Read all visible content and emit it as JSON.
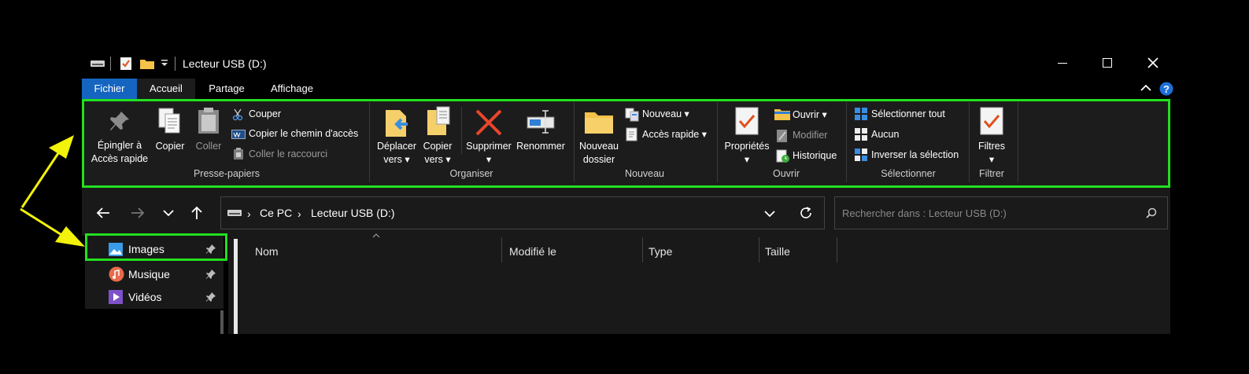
{
  "titlebar": {
    "title": "Lecteur USB (D:)"
  },
  "ribbon_tabs": [
    {
      "label": "Fichier"
    },
    {
      "label": "Accueil"
    },
    {
      "label": "Partage"
    },
    {
      "label": "Affichage"
    }
  ],
  "clipboard": {
    "pin_label_1": "Épingler à",
    "pin_label_2": "Accès rapide",
    "copy_label": "Copier",
    "paste_label": "Coller",
    "cut_label": "Couper",
    "copy_path_label": "Copier le chemin d'accès",
    "paste_shortcut_label": "Coller le raccourci",
    "group_label": "Presse-papiers"
  },
  "organize": {
    "move_label_1": "Déplacer",
    "move_label_2": "vers",
    "copyto_label_1": "Copier",
    "copyto_label_2": "vers",
    "delete_label": "Supprimer",
    "rename_label": "Renommer",
    "group_label": "Organiser"
  },
  "new": {
    "new_folder_label_1": "Nouveau",
    "new_folder_label_2": "dossier",
    "new_item_label": "Nouveau",
    "quick_access_label": "Accès rapide",
    "group_label": "Nouveau"
  },
  "open": {
    "properties_label": "Propriétés",
    "open_label": "Ouvrir",
    "edit_label": "Modifier",
    "history_label": "Historique",
    "group_label": "Ouvrir"
  },
  "select": {
    "select_all_label": "Sélectionner tout",
    "select_none_label": "Aucun",
    "invert_label": "Inverser la sélection",
    "group_label": "Sélectionner"
  },
  "filter": {
    "filters_label": "Filtres",
    "group_label": "Filtrer"
  },
  "address": {
    "crumb_pc": "Ce PC",
    "crumb_drive": "Lecteur USB (D:)"
  },
  "search": {
    "placeholder": "Rechercher dans : Lecteur USB (D:)"
  },
  "nav_items": [
    {
      "label": "Images"
    },
    {
      "label": "Musique"
    },
    {
      "label": "Vidéos"
    }
  ],
  "columns": [
    {
      "label": "Nom"
    },
    {
      "label": "Modifié le"
    },
    {
      "label": "Type"
    },
    {
      "label": "Taille"
    }
  ],
  "colors": {
    "highlight": "#22e01f",
    "arrow": "#f2f20a",
    "fichier_tab": "#1565c0",
    "window_bg": "#191919"
  }
}
